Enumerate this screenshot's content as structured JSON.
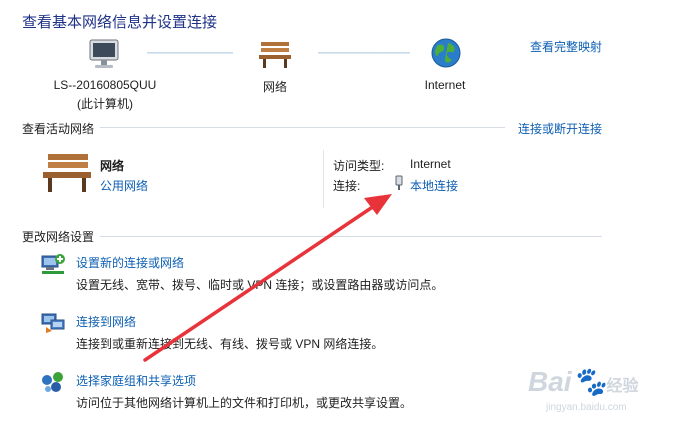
{
  "header": {
    "title": "查看基本网络信息并设置连接",
    "full_map_link": "查看完整映射"
  },
  "network_map": {
    "computer_name": "LS--20160805QUU",
    "computer_sub": "(此计算机)",
    "network_label": "网络",
    "internet_label": "Internet"
  },
  "active_networks": {
    "section_title": "查看活动网络",
    "connect_disconnect": "连接或断开连接",
    "network_name": "网络",
    "network_type": "公用网络",
    "access_type_label": "访问类型:",
    "access_type_value": "Internet",
    "connection_label": "连接:",
    "connection_value": "本地连接"
  },
  "change_settings": {
    "section_title": "更改网络设置",
    "items": [
      {
        "title": "设置新的连接或网络",
        "desc": "设置无线、宽带、拨号、临时或 VPN 连接；或设置路由器或访问点。"
      },
      {
        "title": "连接到网络",
        "desc": "连接到或重新连接到无线、有线、拨号或 VPN 网络连接。"
      },
      {
        "title": "选择家庭组和共享选项",
        "desc": "访问位于其他网络计算机上的文件和打印机，或更改共享设置。"
      }
    ]
  },
  "watermark": {
    "brand": "Bai",
    "brand_cn": "经验",
    "url": "jingyan.baidu.com"
  },
  "colors": {
    "title": "#1e3287",
    "link": "#0d5fb3",
    "arrow": "#e8333a"
  }
}
